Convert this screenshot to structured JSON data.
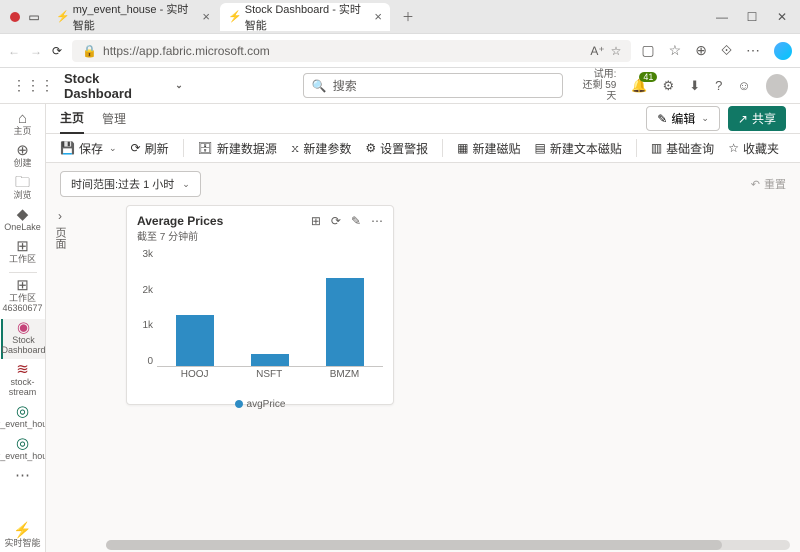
{
  "browser": {
    "tab1_title": "my_event_house - 实时智能",
    "tab2_title": "Stock Dashboard - 实时智能",
    "url": "https://app.fabric.microsoft.com"
  },
  "header": {
    "title": "Stock Dashboard",
    "search_placeholder": "搜索",
    "trial_label": "试用:",
    "trial_remaining": "还剩 59 天",
    "badge_count": "41"
  },
  "left_rail": {
    "home": "主页",
    "create": "创建",
    "browse": "浏览",
    "onelake": "OneLake",
    "workspace": "工作区",
    "workspace_id": "工作区 46360677",
    "stock_dashboard": "Stock Dashboard",
    "stock_stream": "stock-stream",
    "my_event_house1": "my_event_house",
    "my_event_house2": "my_event_house",
    "realtime": "实时智能"
  },
  "tabs": {
    "home": "主页",
    "manage": "管理",
    "edit": "编辑",
    "share": "共享"
  },
  "toolbar": {
    "save": "保存",
    "refresh": "刷新",
    "new_datasource": "新建数据源",
    "new_param": "新建参数",
    "set_alert": "设置警报",
    "new_tile": "新建磁贴",
    "new_text_tile": "新建文本磁贴",
    "base_query": "基础查询",
    "favorites": "收藏夹"
  },
  "timebar": {
    "text": "时间范围:过去 1 小时",
    "reset": "重置"
  },
  "side_panel_label": "页面",
  "card": {
    "title": "Average Prices",
    "subtitle": "截至 7 分钟前",
    "legend": "avgPrice"
  },
  "chart_data": {
    "type": "bar",
    "categories": [
      "HOOJ",
      "NSFT",
      "BMZM"
    ],
    "values": [
      1300,
      300,
      2250
    ],
    "title": "Average Prices",
    "xlabel": "",
    "ylabel": "",
    "ylim": [
      0,
      3000
    ],
    "yticks": [
      "3k",
      "2k",
      "1k",
      "0"
    ],
    "series_name": "avgPrice"
  }
}
